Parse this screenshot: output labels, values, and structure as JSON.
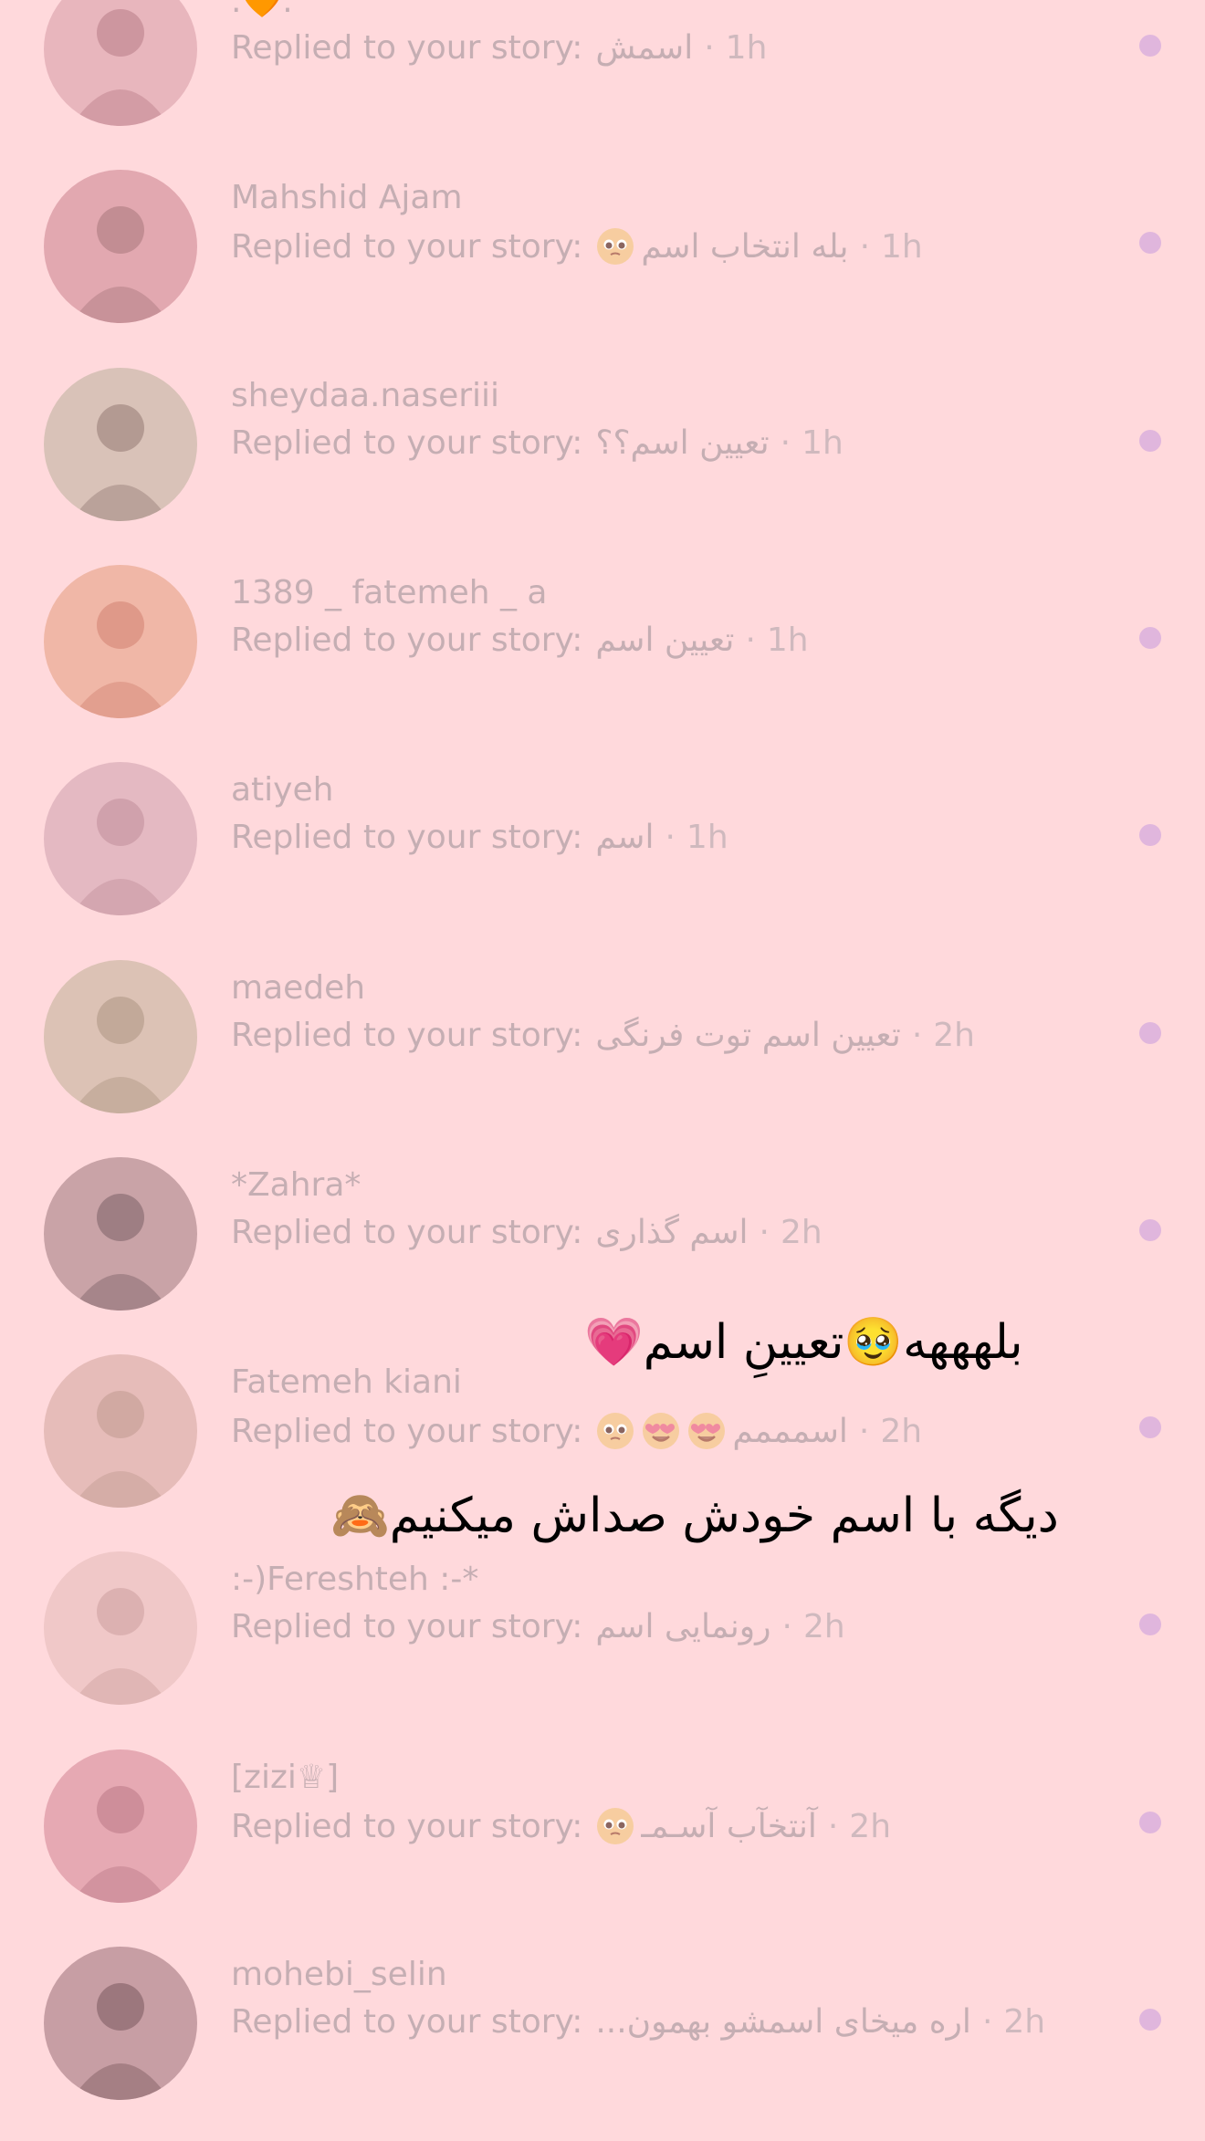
{
  "colors": {
    "background": "#ffd9dc",
    "text_faded": "#c5aeb3",
    "unread_dot": "#e0b6dd",
    "overlay_text": "#000000"
  },
  "rows": [
    {
      "name": ".🧡.",
      "prefix": "Replied to your story:",
      "message": "اسمش",
      "emojis": [],
      "separator": "·",
      "time": "1h",
      "avatar_color": "#e8b6bd"
    },
    {
      "name": "Mahshid Ajam",
      "prefix": "Replied to your story:",
      "message": "بله انتخاب اسم",
      "emojis": [
        "pleading-face-emoji"
      ],
      "separator": "·",
      "time": "1h",
      "avatar_color": "#e2a8b0"
    },
    {
      "name": "sheydaa.naseriii",
      "prefix": "Replied to your story:",
      "message": "تعیین اسم؟؟",
      "emojis": [],
      "separator": "·",
      "time": "1h",
      "avatar_color": "#d9c2b8"
    },
    {
      "name": "1389 _ fatemeh _ a",
      "prefix": "Replied to your story:",
      "message": "تعیین اسم",
      "emojis": [],
      "separator": "·",
      "time": "1h",
      "avatar_color": "#f0b7a7"
    },
    {
      "name": "atiyeh",
      "prefix": "Replied to your story:",
      "message": "اسم",
      "emojis": [],
      "separator": "·",
      "time": "1h",
      "avatar_color": "#e4b9c2"
    },
    {
      "name": "maedeh",
      "prefix": "Replied to your story:",
      "message": "تعیین اسم توت فرنگی",
      "emojis": [],
      "separator": "·",
      "time": "2h",
      "avatar_color": "#dcc2b5"
    },
    {
      "name": "*Zahra*",
      "prefix": "Replied to your story:",
      "message": "اسم گذاری",
      "emojis": [],
      "separator": "·",
      "time": "2h",
      "avatar_color": "#c9a3a7"
    },
    {
      "name": "Fatemeh kiani",
      "prefix": "Replied to your story:",
      "message": "اسمممم",
      "emojis": [
        "pleading-face-emoji",
        "heart-eyes-emoji",
        "heart-eyes-emoji"
      ],
      "separator": "·",
      "time": "2h",
      "avatar_color": "#e6bcb9"
    },
    {
      "name": ":-)Fereshteh :-*",
      "prefix": "Replied to your story:",
      "message": "رونمایی اسم",
      "emojis": [],
      "separator": "·",
      "time": "2h",
      "avatar_color": "#f0c8c8"
    },
    {
      "name": "[zizi♕]",
      "prefix": "Replied to your story:",
      "message": "آنتخآب آسـمـ",
      "emojis": [
        "pleading-face-emoji"
      ],
      "separator": "·",
      "time": "2h",
      "avatar_color": "#e6a9b3"
    },
    {
      "name": "mohebi_selin",
      "prefix": "Replied to your story:",
      "message": "اره میخای اسمشو بهمون...",
      "emojis": [],
      "separator": "·",
      "time": "2h",
      "avatar_color": "#c79ea4"
    }
  ],
  "overlays": [
    {
      "text": "بلهههه🥹تعیینِ اسم💗"
    },
    {
      "text": "دیگه با اسم خودش صداش میکنیم🙈"
    }
  ]
}
